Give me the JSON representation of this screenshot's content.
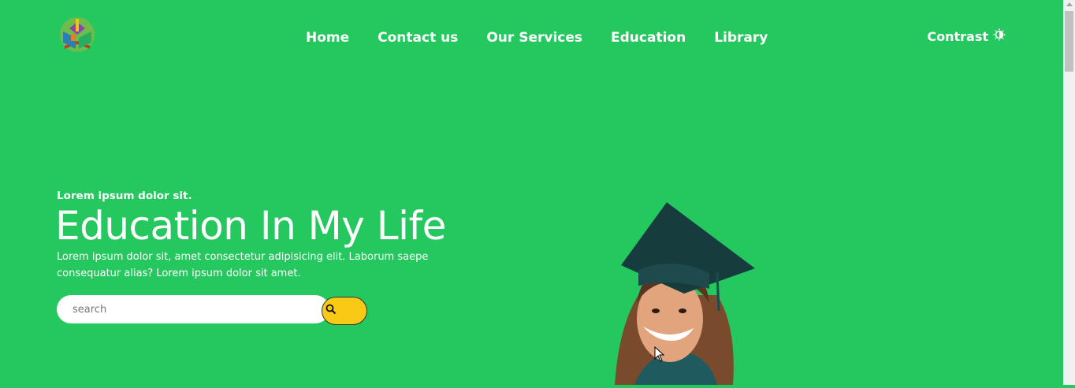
{
  "nav": {
    "logo_icon": "book-stack-logo-icon",
    "items": [
      {
        "label": "Home"
      },
      {
        "label": "Contact us"
      },
      {
        "label": "Our Services"
      },
      {
        "label": "Education"
      },
      {
        "label": "Library"
      }
    ],
    "contrast_label": "Contrast",
    "contrast_icon": "contrast-sun-icon"
  },
  "hero": {
    "eyebrow": "Lorem ipsum dolor sit.",
    "title": "Education In My Life",
    "description": "Lorem ipsum dolor sit, amet consectetur adipisicing elit. Laborum saepe consequatur alias? Lorem ipsum dolor sit amet.",
    "search_placeholder": "search",
    "search_icon": "search-icon"
  },
  "colors": {
    "background": "#25c85f",
    "search_button": "#f8ca16",
    "text": "#ffffff"
  }
}
